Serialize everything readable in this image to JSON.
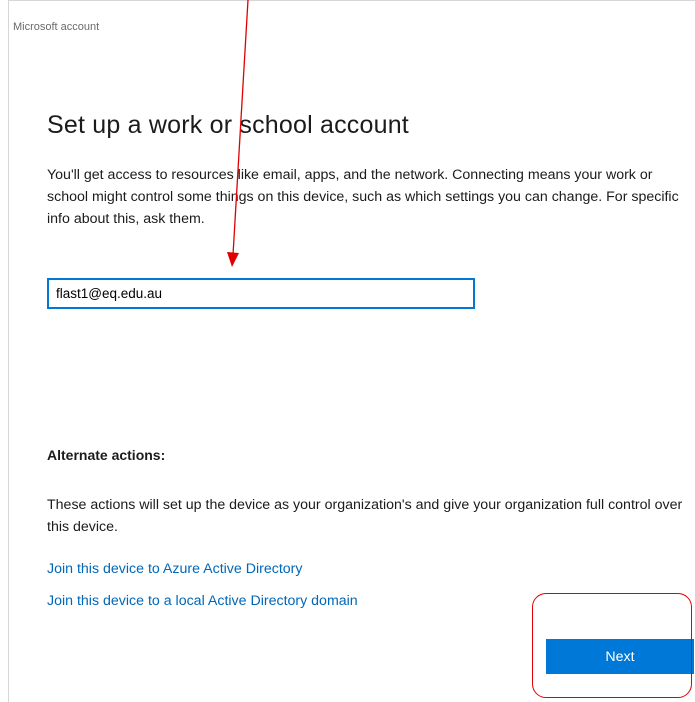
{
  "window": {
    "title": "Microsoft account"
  },
  "main": {
    "heading": "Set up a work or school account",
    "description": "You'll get access to resources like email, apps, and the network. Connecting means your work or school might control some things on this device, such as which settings you can change. For specific info about this, ask them.",
    "email_field": {
      "value": "flast1@eq.edu.au",
      "placeholder": ""
    }
  },
  "alternate": {
    "heading": "Alternate actions:",
    "description": "These actions will set up the device as your organization's and give your organization full control over this device.",
    "links": [
      {
        "label": "Join this device to Azure Active Directory"
      },
      {
        "label": "Join this device to a local Active Directory domain"
      }
    ]
  },
  "footer": {
    "next_label": "Next"
  },
  "colors": {
    "accent": "#0078d7",
    "link": "#0067b8",
    "annotation": "#e00000"
  }
}
